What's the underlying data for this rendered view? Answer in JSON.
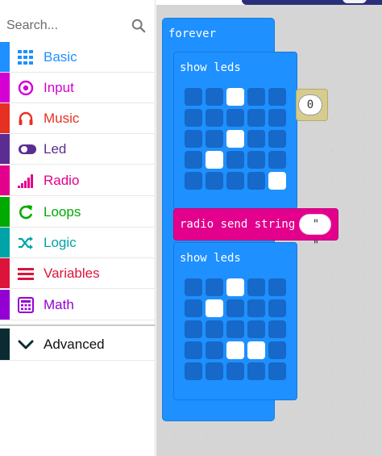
{
  "search": {
    "placeholder": "Search..."
  },
  "categories": [
    {
      "label": "Basic",
      "color": "#1e90ff",
      "icon": "grid-icon"
    },
    {
      "label": "Input",
      "color": "#d400d4",
      "icon": "target-icon"
    },
    {
      "label": "Music",
      "color": "#e63022",
      "icon": "headphones-icon"
    },
    {
      "label": "Led",
      "color": "#5c2d91",
      "icon": "toggle-icon"
    },
    {
      "label": "Radio",
      "color": "#e3008c",
      "icon": "signal-bars-icon"
    },
    {
      "label": "Loops",
      "color": "#00aa00",
      "icon": "refresh-icon"
    },
    {
      "label": "Logic",
      "color": "#00a4a6",
      "icon": "shuffle-icon"
    },
    {
      "label": "Variables",
      "color": "#dc143c",
      "icon": "list-lines-icon"
    },
    {
      "label": "Math",
      "color": "#9400d3",
      "icon": "calculator-icon"
    }
  ],
  "advanced": {
    "label": "Advanced",
    "color": "#0b2b33",
    "icon": "chevron-down-icon"
  },
  "workspace": {
    "forever_label": "forever",
    "show_leds_1": {
      "label": "show leds",
      "grid": [
        [
          0,
          0,
          1,
          0,
          0
        ],
        [
          0,
          0,
          0,
          0,
          0
        ],
        [
          0,
          0,
          1,
          0,
          0
        ],
        [
          0,
          1,
          0,
          0,
          0
        ],
        [
          0,
          0,
          0,
          0,
          1
        ]
      ]
    },
    "number_value": "0",
    "radio_send": {
      "label": "radio send string",
      "value": "\" \""
    },
    "show_leds_2": {
      "label": "show leds",
      "grid": [
        [
          0,
          0,
          1,
          0,
          0
        ],
        [
          0,
          1,
          0,
          0,
          0
        ],
        [
          0,
          0,
          0,
          0,
          0
        ],
        [
          0,
          0,
          1,
          1,
          0
        ],
        [
          0,
          0,
          0,
          0,
          0
        ]
      ]
    }
  },
  "colors": {
    "block_blue": "#1e90ff",
    "radio_pink": "#e3008c",
    "number_tan": "#d6cc8e",
    "led_off": "#1668c9",
    "led_on": "#ffffff"
  }
}
